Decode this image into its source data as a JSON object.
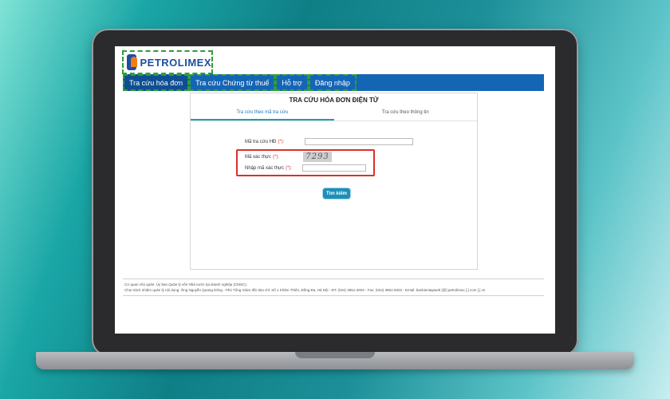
{
  "logo": {
    "text": "PETROLIMEX",
    "icon": "petrolimex-logo-icon"
  },
  "nav": [
    {
      "label": "Tra cứu hóa đơn",
      "active": true
    },
    {
      "label": "Tra cứu Chứng từ thuế",
      "active": false
    },
    {
      "label": "Hỗ trợ",
      "active": false
    },
    {
      "label": "Đăng nhập",
      "active": false
    }
  ],
  "panel": {
    "title": "TRA CỨU HÓA ĐƠN ĐIỆN TỬ",
    "tabs": [
      {
        "label": "Tra cứu theo mã tra cứu",
        "active": true
      },
      {
        "label": "Tra cứu theo thông tin",
        "active": false
      }
    ],
    "fields": {
      "lookup_label": "Mã tra cứu HĐ",
      "captcha_label": "Mã xác thực",
      "captcha_input_label": "Nhập mã xác thực",
      "required_mark": "(*):",
      "captcha_code": "7293",
      "lookup_value": "",
      "captcha_value": ""
    },
    "search_button": "Tìm kiếm"
  },
  "footer": {
    "line1": "Cơ quan chủ quản: Ủy ban Quản lý vốn Nhà nước tại doanh nghiệp (CMSC).",
    "line2": "Chịu trách nhiệm quản lý nội dung: Ông Nguyễn Quang Dũng - Phó Tổng Giám đốc Địa chỉ: Số 1 Khâm Thiên, Đống Đa, Hà Nội - ĐT: (024) 3851-2603 - Fax: (024) 3851-9203 - Email: banbientapweb [@] petrolimex [.] com [.] vn"
  },
  "colors": {
    "nav_bg": "#1565b5",
    "accent": "#1c8fb8",
    "highlight_box": "#d9312b",
    "dashed_highlight": "#2e9e3a"
  }
}
